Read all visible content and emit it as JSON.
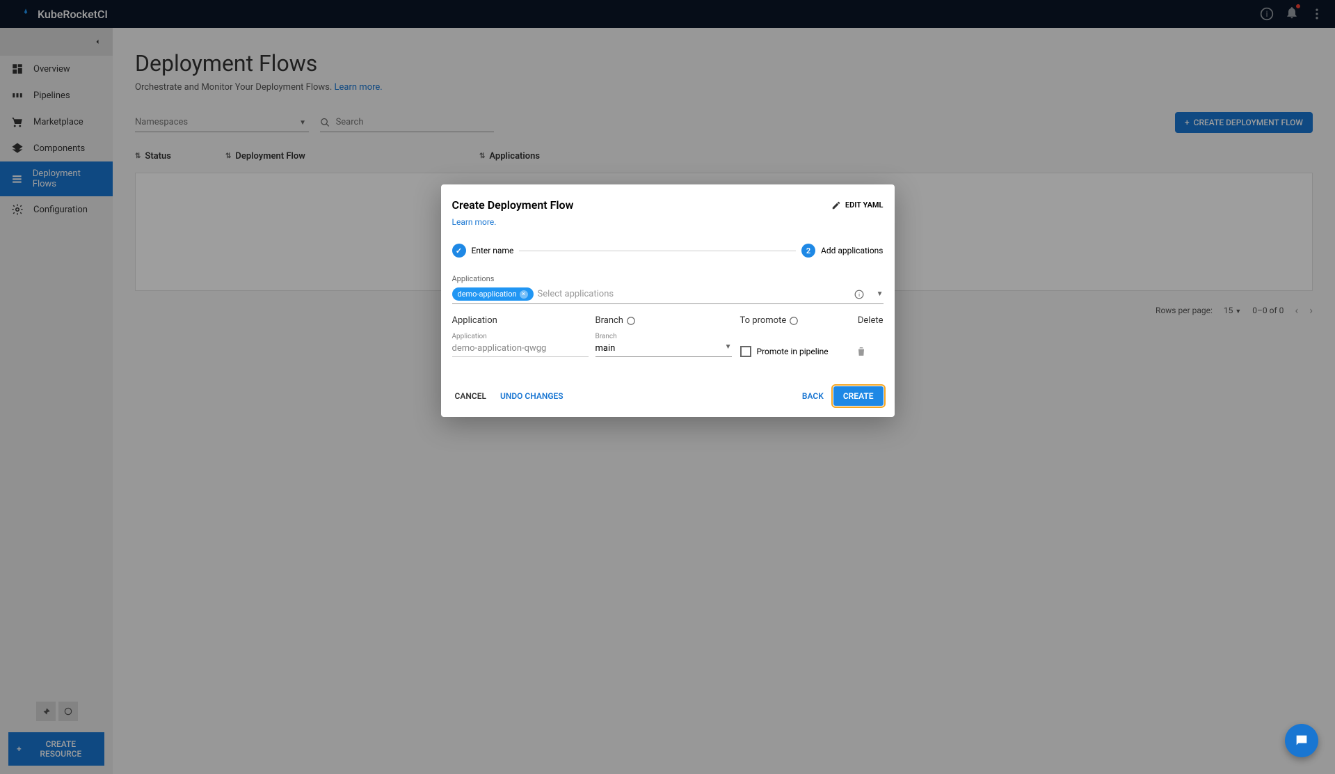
{
  "header": {
    "brand": "KubeRocketCI"
  },
  "sidebar": {
    "items": [
      {
        "label": "Overview"
      },
      {
        "label": "Pipelines"
      },
      {
        "label": "Marketplace"
      },
      {
        "label": "Components"
      },
      {
        "label": "Deployment Flows"
      },
      {
        "label": "Configuration"
      }
    ],
    "createResource": "CREATE RESOURCE"
  },
  "page": {
    "title": "Deployment Flows",
    "subtitle": "Orchestrate and Monitor Your Deployment Flows. ",
    "learnMore": "Learn more."
  },
  "filters": {
    "namespaces": "Namespaces",
    "searchPlaceholder": "Search"
  },
  "actions": {
    "createFlow": "CREATE DEPLOYMENT FLOW"
  },
  "table": {
    "cols": {
      "status": "Status",
      "flow": "Deployment Flow",
      "apps": "Applications"
    }
  },
  "pagination": {
    "rowsLabel": "Rows per page:",
    "rows": "15",
    "range": "0–0 of 0"
  },
  "modal": {
    "title": "Create Deployment Flow",
    "editYaml": "EDIT YAML",
    "learnMore": "Learn more.",
    "step1": "Enter name",
    "step2": "Add applications",
    "step2num": "2",
    "appsLabel": "Applications",
    "chip": "demo-application",
    "appsPlaceholder": "Select applications",
    "cols": {
      "app": "Application",
      "branch": "Branch",
      "promote": "To promote",
      "delete": "Delete"
    },
    "row": {
      "appLabel": "Application",
      "appValue": "demo-application-qwgg",
      "branchLabel": "Branch",
      "branchValue": "main",
      "promoteLabel": "Promote in pipeline"
    },
    "footer": {
      "cancel": "CANCEL",
      "undo": "UNDO CHANGES",
      "back": "BACK",
      "create": "CREATE"
    }
  }
}
